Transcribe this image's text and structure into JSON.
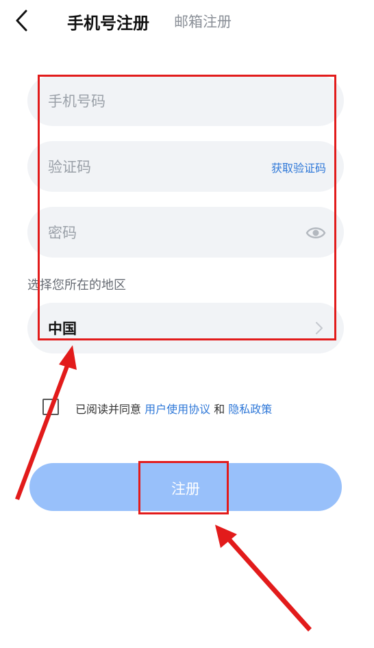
{
  "header": {
    "tab_phone": "手机号注册",
    "tab_email": "邮箱注册"
  },
  "form": {
    "phone_placeholder": "手机号码",
    "code_placeholder": "验证码",
    "get_code_label": "获取验证码",
    "password_placeholder": "密码",
    "region_label": "选择您所在的地区",
    "region_value": "中国"
  },
  "agreement": {
    "prefix": "已阅读并同意 ",
    "terms_link": "用户使用协议",
    "and": " 和 ",
    "privacy_link": "隐私政策",
    "checked": false
  },
  "submit": {
    "label": "注册"
  },
  "colors": {
    "accent_link": "#2f78d8",
    "button_bg": "#98c0fa",
    "field_bg": "#f1f3f6",
    "annotation_red": "#e21b1b"
  },
  "icons": {
    "back": "chevron-left-icon",
    "password_toggle": "eye-icon",
    "region_arrow": "chevron-right-icon"
  }
}
